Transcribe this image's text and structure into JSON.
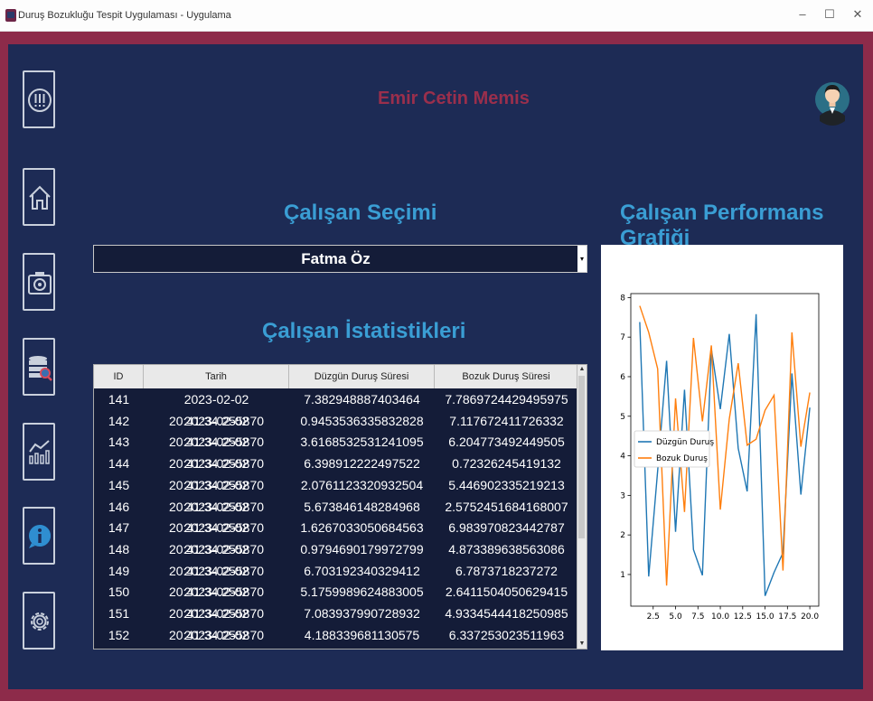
{
  "window": {
    "title": "Duruş Bozukluğu Tespit Uygulaması - Uygulama",
    "min_glyph": "–",
    "max_glyph": "☐",
    "close_glyph": "✕"
  },
  "colors": {
    "frame": "#8d2b4a",
    "panel": "#1d2b55",
    "heading": "#3a9ed4",
    "username": "#9a2f4c",
    "series1": "#1f77b4",
    "series2": "#ff7f0e"
  },
  "sidebar": {
    "items": [
      {
        "name": "alert-icon"
      },
      {
        "name": "home-icon"
      },
      {
        "name": "camera-icon"
      },
      {
        "name": "database-search-icon"
      },
      {
        "name": "chart-icon"
      },
      {
        "name": "info-icon"
      },
      {
        "name": "settings-icon"
      }
    ]
  },
  "header": {
    "user_name": "Emir Cetin Memis"
  },
  "employee_select": {
    "heading": "Çalışan Seçimi",
    "selected": "Fatma Öz",
    "arrow": "▾"
  },
  "stats": {
    "heading": "Çalışan İstatistikleri",
    "columns": [
      "ID",
      "Tarih",
      "Düzgün Duruş Süresi",
      "Bozuk Duruş Süresi"
    ],
    "rows": [
      [
        "141",
        "2023-02-02 20:41:34.255870",
        "7.382948887403464",
        "7.7869724429495975"
      ],
      [
        "142",
        "2023-02-02 20:41:34.255870",
        "0.9453536335832828",
        "7.117672411726332"
      ],
      [
        "143",
        "2023-02-02 20:41:34.255870",
        "3.6168532531241095",
        "6.204773492449505"
      ],
      [
        "144",
        "2023-02-02 20:41:34.255870",
        "6.398912222497522",
        "0.72326245419132"
      ],
      [
        "145",
        "2023-02-02 20:41:34.255870",
        "2.0761123320932504",
        "5.446902335219213"
      ],
      [
        "146",
        "2023-02-02 20:41:34.255870",
        "5.673846148284968",
        "2.5752451684168007"
      ],
      [
        "147",
        "2023-02-02 20:41:34.255870",
        "1.6267033050684563",
        "6.983970823442787"
      ],
      [
        "148",
        "2023-02-02 20:41:34.255870",
        "0.9794690179972799",
        "4.873389638563086"
      ],
      [
        "149",
        "2023-02-02 20:41:34.255870",
        "6.703192340329412",
        "6.7873718237272"
      ],
      [
        "150",
        "2023-02-02 20:41:34.255870",
        "5.1759989624883005",
        "2.6411504050629415"
      ],
      [
        "151",
        "2023-02-02 20:41:34.255870",
        "7.083937990728932",
        "4.9334544418250985"
      ],
      [
        "152",
        "2023-02-02 20:41:34.255870",
        "4.188339681130575",
        "6.337253023511963"
      ]
    ]
  },
  "performance": {
    "heading": "Çalışan Performans Grafiği"
  },
  "chart_data": {
    "type": "line",
    "title": "",
    "xlabel": "",
    "ylabel": "",
    "xlim": [
      0,
      21
    ],
    "ylim": [
      0.2,
      8.1
    ],
    "x_ticks": [
      2.5,
      5.0,
      7.5,
      10.0,
      12.5,
      15.0,
      17.5,
      20.0
    ],
    "x_tick_labels": [
      "2.5",
      "5.0",
      "7.5",
      "10.0",
      "12.5",
      "15.0",
      "17.5",
      "20.0"
    ],
    "y_ticks": [
      1,
      2,
      3,
      4,
      5,
      6,
      7,
      8
    ],
    "y_tick_labels": [
      "1",
      "2",
      "3",
      "4",
      "5",
      "6",
      "7",
      "8"
    ],
    "legend_position": "center-left",
    "x": [
      1,
      2,
      3,
      4,
      5,
      6,
      7,
      8,
      9,
      10,
      11,
      12,
      13,
      14,
      15,
      16,
      17,
      18,
      19,
      20
    ],
    "series": [
      {
        "name": "Düzgün Duruş",
        "values": [
          7.38,
          0.95,
          3.62,
          6.4,
          2.08,
          5.67,
          1.63,
          0.98,
          6.7,
          5.18,
          7.08,
          4.19,
          3.1,
          7.58,
          0.46,
          1.05,
          1.55,
          6.08,
          3.02,
          5.22
        ]
      },
      {
        "name": "Bozuk Duruş",
        "values": [
          7.79,
          7.12,
          6.2,
          0.72,
          5.45,
          2.58,
          6.98,
          4.87,
          6.79,
          2.64,
          4.93,
          6.34,
          4.27,
          4.42,
          5.15,
          5.53,
          1.1,
          7.12,
          4.23,
          5.6
        ]
      }
    ]
  }
}
